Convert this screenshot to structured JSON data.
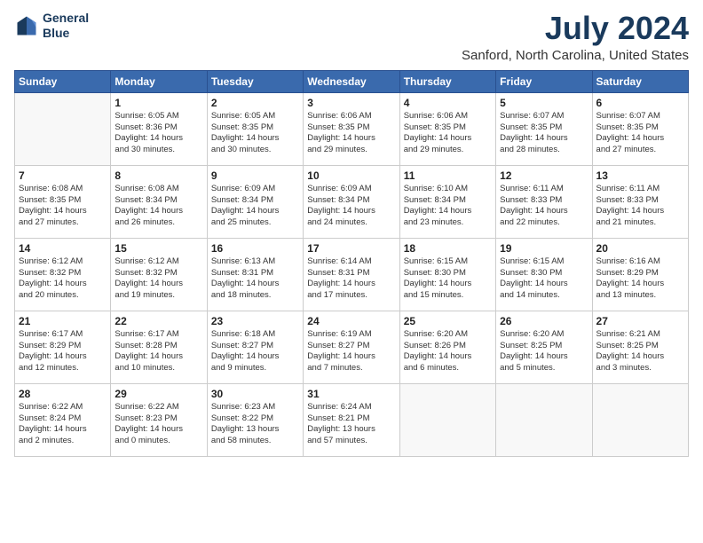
{
  "header": {
    "logo_line1": "General",
    "logo_line2": "Blue",
    "month_title": "July 2024",
    "location": "Sanford, North Carolina, United States"
  },
  "days_of_week": [
    "Sunday",
    "Monday",
    "Tuesday",
    "Wednesday",
    "Thursday",
    "Friday",
    "Saturday"
  ],
  "weeks": [
    [
      {
        "day": "",
        "content": ""
      },
      {
        "day": "1",
        "content": "Sunrise: 6:05 AM\nSunset: 8:36 PM\nDaylight: 14 hours\nand 30 minutes."
      },
      {
        "day": "2",
        "content": "Sunrise: 6:05 AM\nSunset: 8:35 PM\nDaylight: 14 hours\nand 30 minutes."
      },
      {
        "day": "3",
        "content": "Sunrise: 6:06 AM\nSunset: 8:35 PM\nDaylight: 14 hours\nand 29 minutes."
      },
      {
        "day": "4",
        "content": "Sunrise: 6:06 AM\nSunset: 8:35 PM\nDaylight: 14 hours\nand 29 minutes."
      },
      {
        "day": "5",
        "content": "Sunrise: 6:07 AM\nSunset: 8:35 PM\nDaylight: 14 hours\nand 28 minutes."
      },
      {
        "day": "6",
        "content": "Sunrise: 6:07 AM\nSunset: 8:35 PM\nDaylight: 14 hours\nand 27 minutes."
      }
    ],
    [
      {
        "day": "7",
        "content": "Sunrise: 6:08 AM\nSunset: 8:35 PM\nDaylight: 14 hours\nand 27 minutes."
      },
      {
        "day": "8",
        "content": "Sunrise: 6:08 AM\nSunset: 8:34 PM\nDaylight: 14 hours\nand 26 minutes."
      },
      {
        "day": "9",
        "content": "Sunrise: 6:09 AM\nSunset: 8:34 PM\nDaylight: 14 hours\nand 25 minutes."
      },
      {
        "day": "10",
        "content": "Sunrise: 6:09 AM\nSunset: 8:34 PM\nDaylight: 14 hours\nand 24 minutes."
      },
      {
        "day": "11",
        "content": "Sunrise: 6:10 AM\nSunset: 8:34 PM\nDaylight: 14 hours\nand 23 minutes."
      },
      {
        "day": "12",
        "content": "Sunrise: 6:11 AM\nSunset: 8:33 PM\nDaylight: 14 hours\nand 22 minutes."
      },
      {
        "day": "13",
        "content": "Sunrise: 6:11 AM\nSunset: 8:33 PM\nDaylight: 14 hours\nand 21 minutes."
      }
    ],
    [
      {
        "day": "14",
        "content": "Sunrise: 6:12 AM\nSunset: 8:32 PM\nDaylight: 14 hours\nand 20 minutes."
      },
      {
        "day": "15",
        "content": "Sunrise: 6:12 AM\nSunset: 8:32 PM\nDaylight: 14 hours\nand 19 minutes."
      },
      {
        "day": "16",
        "content": "Sunrise: 6:13 AM\nSunset: 8:31 PM\nDaylight: 14 hours\nand 18 minutes."
      },
      {
        "day": "17",
        "content": "Sunrise: 6:14 AM\nSunset: 8:31 PM\nDaylight: 14 hours\nand 17 minutes."
      },
      {
        "day": "18",
        "content": "Sunrise: 6:15 AM\nSunset: 8:30 PM\nDaylight: 14 hours\nand 15 minutes."
      },
      {
        "day": "19",
        "content": "Sunrise: 6:15 AM\nSunset: 8:30 PM\nDaylight: 14 hours\nand 14 minutes."
      },
      {
        "day": "20",
        "content": "Sunrise: 6:16 AM\nSunset: 8:29 PM\nDaylight: 14 hours\nand 13 minutes."
      }
    ],
    [
      {
        "day": "21",
        "content": "Sunrise: 6:17 AM\nSunset: 8:29 PM\nDaylight: 14 hours\nand 12 minutes."
      },
      {
        "day": "22",
        "content": "Sunrise: 6:17 AM\nSunset: 8:28 PM\nDaylight: 14 hours\nand 10 minutes."
      },
      {
        "day": "23",
        "content": "Sunrise: 6:18 AM\nSunset: 8:27 PM\nDaylight: 14 hours\nand 9 minutes."
      },
      {
        "day": "24",
        "content": "Sunrise: 6:19 AM\nSunset: 8:27 PM\nDaylight: 14 hours\nand 7 minutes."
      },
      {
        "day": "25",
        "content": "Sunrise: 6:20 AM\nSunset: 8:26 PM\nDaylight: 14 hours\nand 6 minutes."
      },
      {
        "day": "26",
        "content": "Sunrise: 6:20 AM\nSunset: 8:25 PM\nDaylight: 14 hours\nand 5 minutes."
      },
      {
        "day": "27",
        "content": "Sunrise: 6:21 AM\nSunset: 8:25 PM\nDaylight: 14 hours\nand 3 minutes."
      }
    ],
    [
      {
        "day": "28",
        "content": "Sunrise: 6:22 AM\nSunset: 8:24 PM\nDaylight: 14 hours\nand 2 minutes."
      },
      {
        "day": "29",
        "content": "Sunrise: 6:22 AM\nSunset: 8:23 PM\nDaylight: 14 hours\nand 0 minutes."
      },
      {
        "day": "30",
        "content": "Sunrise: 6:23 AM\nSunset: 8:22 PM\nDaylight: 13 hours\nand 58 minutes."
      },
      {
        "day": "31",
        "content": "Sunrise: 6:24 AM\nSunset: 8:21 PM\nDaylight: 13 hours\nand 57 minutes."
      },
      {
        "day": "",
        "content": ""
      },
      {
        "day": "",
        "content": ""
      },
      {
        "day": "",
        "content": ""
      }
    ]
  ]
}
